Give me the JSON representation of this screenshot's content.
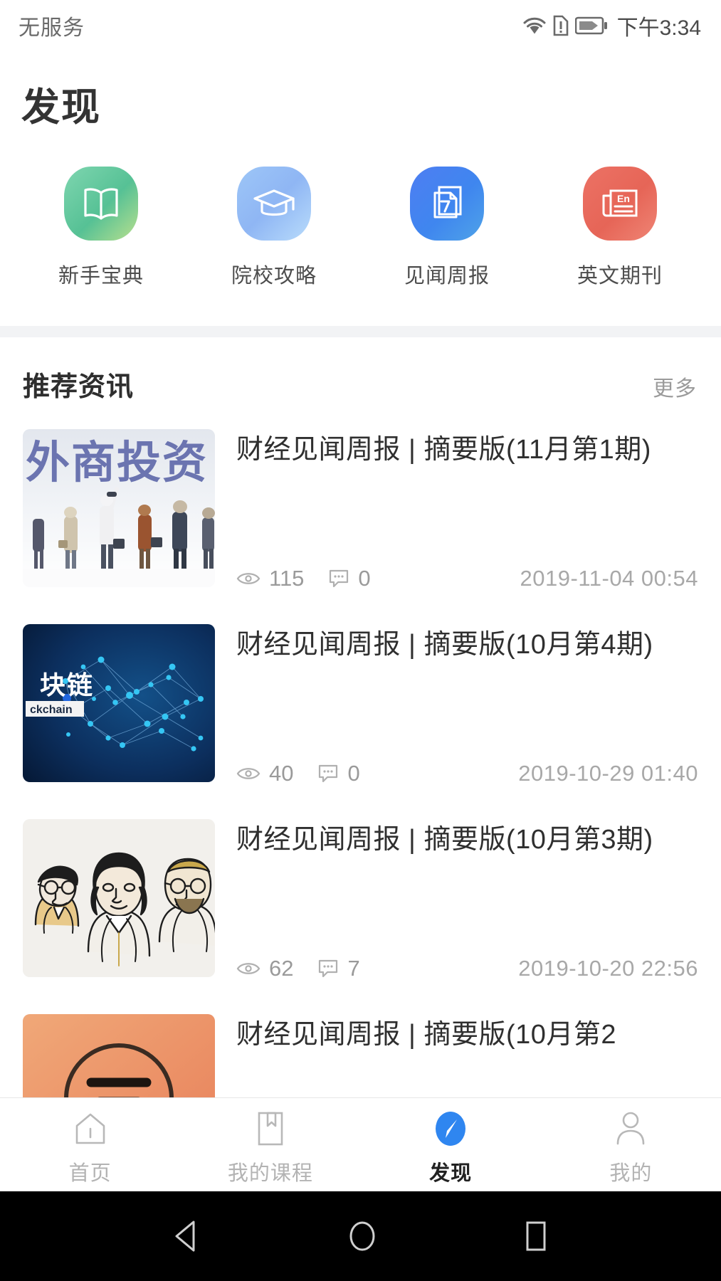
{
  "status_bar": {
    "carrier": "无服务",
    "time": "下午3:34",
    "icons": [
      "wifi-icon",
      "sim-alert-icon",
      "battery-charging-icon"
    ]
  },
  "header": {
    "title": "发现"
  },
  "shortcuts": [
    {
      "label": "新手宝典",
      "icon": "open-book-icon",
      "color": "#5ec79a"
    },
    {
      "label": "院校攻略",
      "icon": "graduation-cap-icon",
      "color": "#93b8f2"
    },
    {
      "label": "见闻周报",
      "icon": "documents-7-icon",
      "color": "#3c7ef0"
    },
    {
      "label": "英文期刊",
      "icon": "newspaper-en-icon",
      "color": "#e8685c"
    }
  ],
  "section": {
    "title": "推荐资讯",
    "more_label": "更多"
  },
  "articles": [
    {
      "title": "财经见闻周报 | 摘要版(11月第1期)",
      "views": "115",
      "comments": "0",
      "date": "2019-11-04 00:54",
      "thumb": "foreign-investment-thumb",
      "thumb_text": "外商投资"
    },
    {
      "title": "财经见闻周报 | 摘要版(10月第4期)",
      "views": "40",
      "comments": "0",
      "date": "2019-10-29 01:40",
      "thumb": "blockchain-thumb",
      "thumb_text": "块链",
      "thumb_subtext": "ckchain"
    },
    {
      "title": "财经见闻周报 | 摘要版(10月第3期)",
      "views": "62",
      "comments": "7",
      "date": "2019-10-20 22:56",
      "thumb": "nobel-portraits-thumb",
      "thumb_text": ""
    },
    {
      "title": "财经见闻周报 | 摘要版(10月第2",
      "views": "",
      "comments": "",
      "date": "",
      "thumb": "orange-circle-thumb",
      "thumb_text": ""
    }
  ],
  "tabbar": {
    "items": [
      {
        "label": "首页",
        "icon": "home-icon",
        "active": false
      },
      {
        "label": "我的课程",
        "icon": "bookmark-course-icon",
        "active": false
      },
      {
        "label": "发现",
        "icon": "compass-icon",
        "active": true
      },
      {
        "label": "我的",
        "icon": "person-icon",
        "active": false
      }
    ],
    "active_color": "#2f86f0",
    "inactive_color": "#b3b3b3"
  },
  "android_nav": {
    "back": "back-triangle-icon",
    "home": "home-circle-icon",
    "recents": "recents-square-icon"
  }
}
